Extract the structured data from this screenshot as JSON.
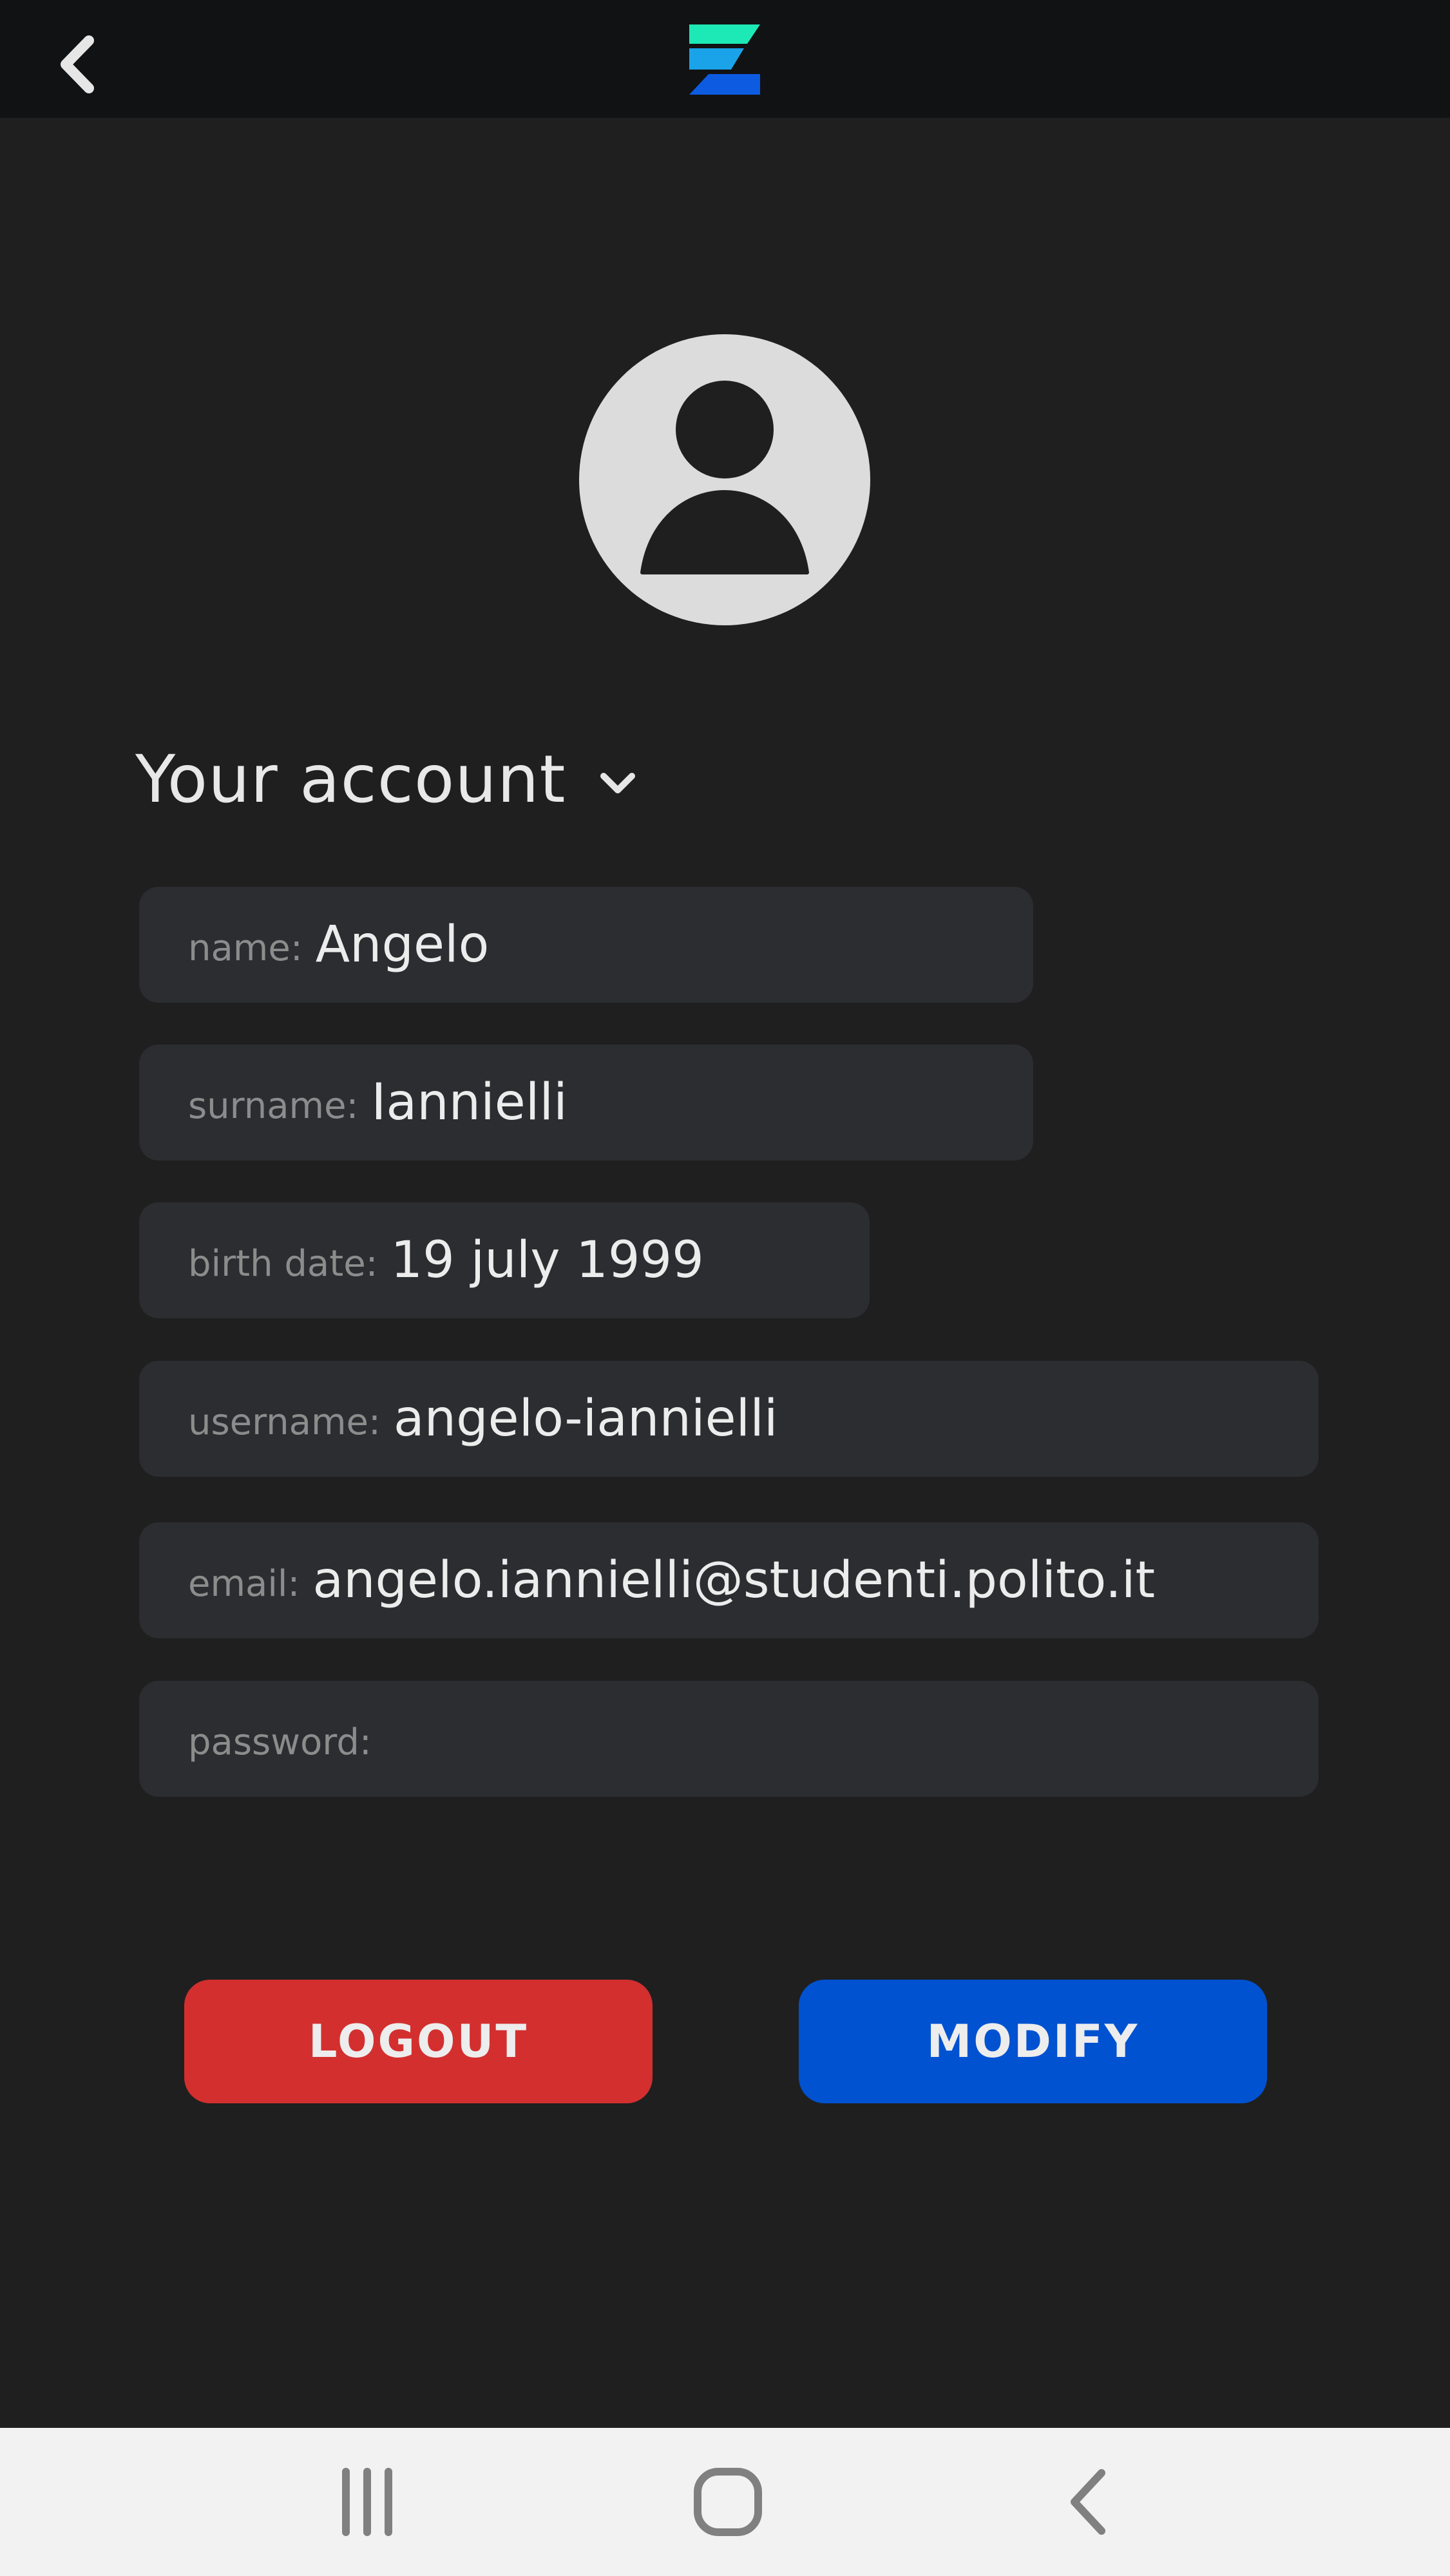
{
  "header": {
    "back_icon": "chevron-left-icon",
    "logo": {
      "name": "app-logo",
      "colors": [
        "#1de9b6",
        "#1aa3e8",
        "#0d5be0"
      ]
    }
  },
  "profile": {
    "avatar_icon": "user-avatar-icon"
  },
  "account_section": {
    "title": "Your account",
    "toggle_icon": "chevron-down-icon"
  },
  "fields": {
    "name": {
      "label": "name:",
      "value": "Angelo"
    },
    "surname": {
      "label": "surname:",
      "value": "Iannielli"
    },
    "birth_date": {
      "label": "birth date:",
      "value": "19 july 1999"
    },
    "username": {
      "label": "username:",
      "value": "angelo-iannielli"
    },
    "email": {
      "label": "email:",
      "value": "angelo.iannielli@studenti.polito.it"
    },
    "password": {
      "label": "password:",
      "value": ""
    }
  },
  "actions": {
    "logout_label": "LOGOUT",
    "modify_label": "MODIFY"
  },
  "colors": {
    "logout": "#d32f2f",
    "modify": "#0052d1",
    "background": "#1f1f1f",
    "field_bg": "#2c2d31"
  },
  "system_nav": {
    "recents_icon": "recent-apps-icon",
    "home_icon": "home-icon",
    "back_icon": "back-icon"
  }
}
